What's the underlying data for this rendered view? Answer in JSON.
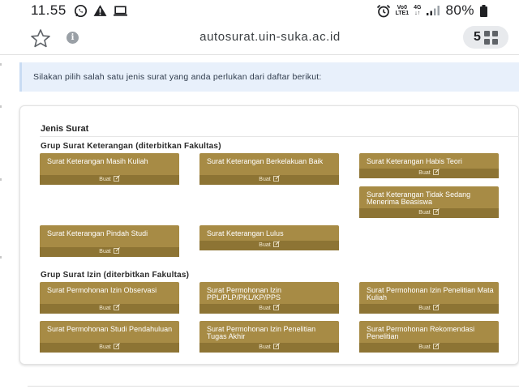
{
  "status_bar": {
    "time": "11.55",
    "network_top": "Vo0",
    "network_bottom": "LTE1",
    "net_type_top": "4G",
    "battery": "80%"
  },
  "browser": {
    "url": "autosurat.uin-suka.ac.id",
    "tab_count": "5"
  },
  "info_message": "Silakan pilih salah satu jenis surat yang anda perlukan dari daftar berikut:",
  "card": {
    "title": "Jenis Surat",
    "make_label": "Buat",
    "groups": [
      {
        "title": "Grup Surat Keterangan (diterbitkan Fakultas)",
        "items": [
          "Surat Keterangan Masih Kuliah",
          "Surat Keterangan Berkelakuan Baik",
          "Surat Keterangan Habis Teori",
          "Surat Keterangan Tidak Sedang Menerima Beasiswa",
          "Surat Keterangan Pindah Studi",
          "Surat Keterangan Lulus"
        ]
      },
      {
        "title": "Grup Surat Izin (diterbitkan Fakultas)",
        "items": [
          "Surat Permohonan Izin Observasi",
          "Surat Permohonan Izin PPL/PLP/PKL/KP/PPS",
          "Surat Permohonan Izin Penelitian Mata Kuliah",
          "Surat Permohonan Studi Pendahuluan",
          "Surat Permohonan Izin Penelitian Tugas Akhir",
          "Surat Permohonan Rekomendasi Penelitian"
        ]
      }
    ]
  }
}
